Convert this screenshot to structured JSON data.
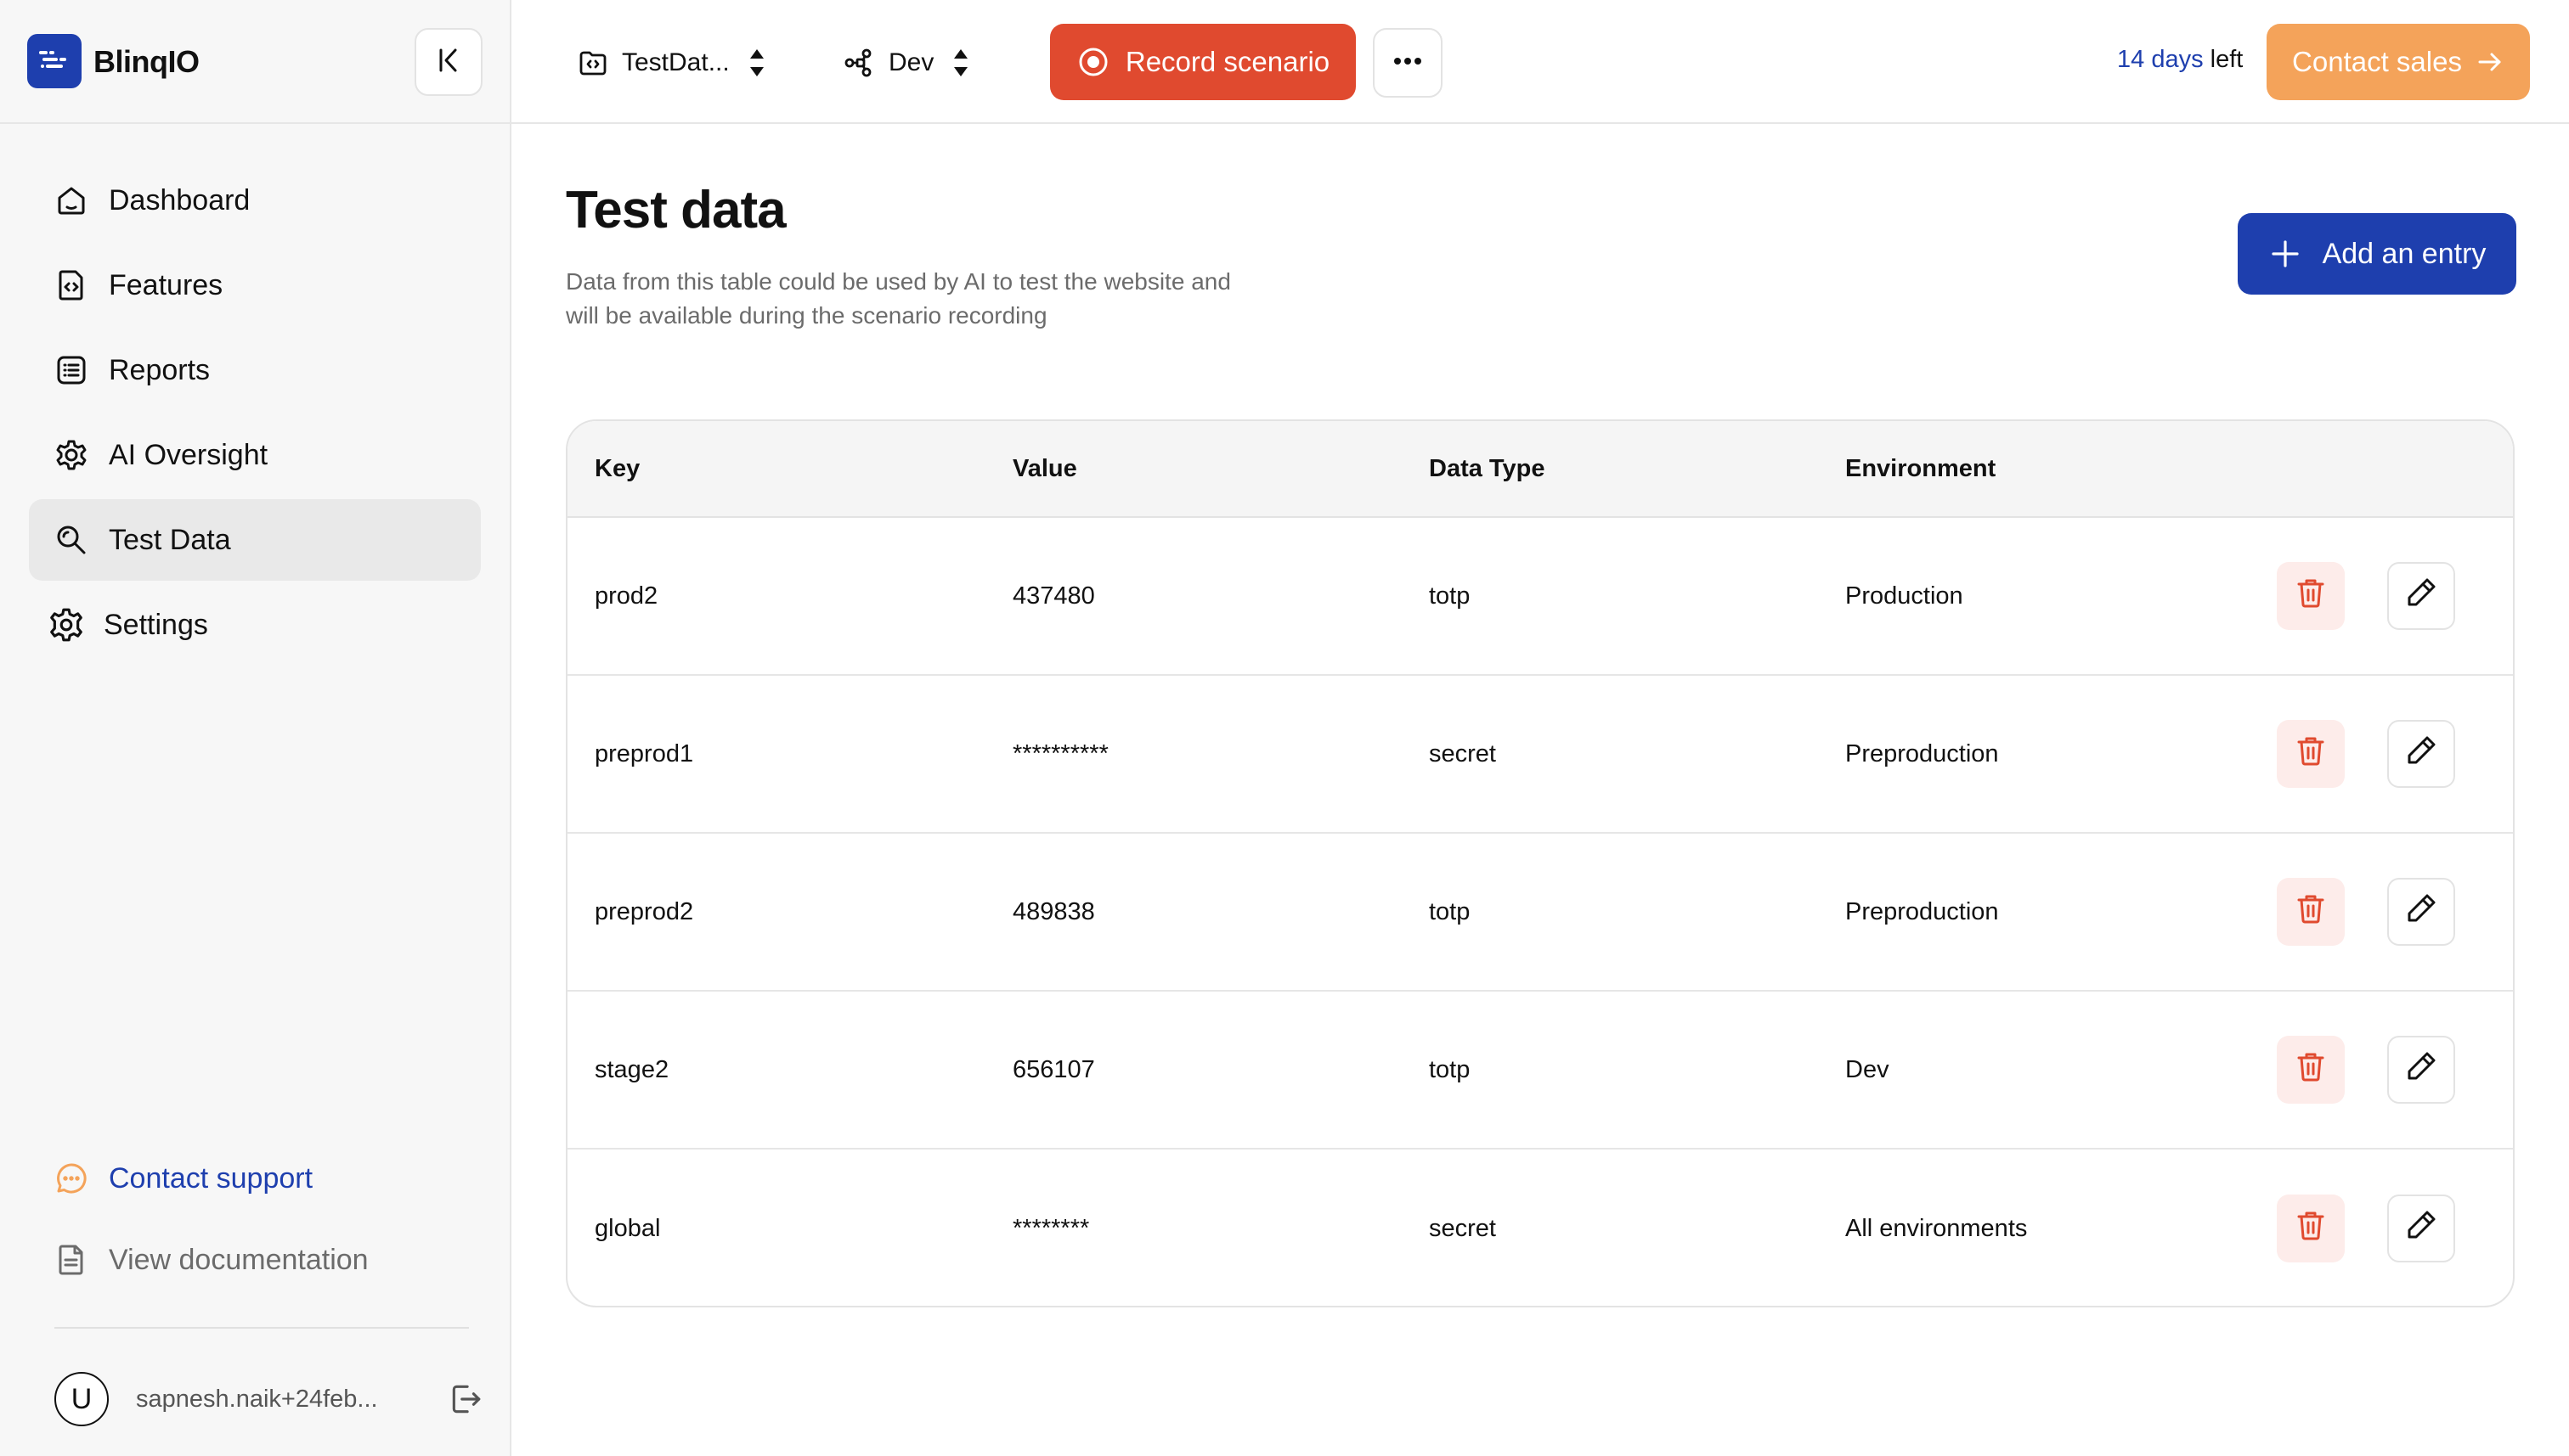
{
  "brand": {
    "name": "BlinqIO",
    "logo_icon": "blinqio-logo-icon"
  },
  "sidebar": {
    "items": [
      {
        "label": "Dashboard",
        "icon": "home-icon",
        "active": false
      },
      {
        "label": "Features",
        "icon": "feature-file-icon",
        "active": false
      },
      {
        "label": "Reports",
        "icon": "report-list-icon",
        "active": false
      },
      {
        "label": "AI Oversight",
        "icon": "ai-gear-icon",
        "active": false
      },
      {
        "label": "Test Data",
        "icon": "data-search-icon",
        "active": true
      },
      {
        "label": "Settings",
        "icon": "settings-icon",
        "active": false
      }
    ],
    "contact_support": "Contact support",
    "view_documentation": "View documentation",
    "user": {
      "initial": "U",
      "email": "sapnesh.naik+24feb..."
    }
  },
  "topbar": {
    "project_selector": "TestDat...",
    "environment_selector": "Dev",
    "record_label": "Record scenario",
    "trial_days": "14 days",
    "trial_suffix": " left",
    "contact_sales_label": "Contact sales"
  },
  "page": {
    "title": "Test data",
    "subtitle": "Data from this table could be used by AI to test the website and will be available during the scenario recording",
    "add_button": "Add an entry"
  },
  "table": {
    "columns": [
      "Key",
      "Value",
      "Data Type",
      "Environment"
    ],
    "rows": [
      {
        "key": "prod2",
        "value": "437480",
        "type": "totp",
        "environment": "Production"
      },
      {
        "key": "preprod1",
        "value": "**********",
        "type": "secret",
        "environment": "Preproduction"
      },
      {
        "key": "preprod2",
        "value": "489838",
        "type": "totp",
        "environment": "Preproduction"
      },
      {
        "key": "stage2",
        "value": "656107",
        "type": "totp",
        "environment": "Dev"
      },
      {
        "key": "global",
        "value": "********",
        "type": "secret",
        "environment": "All environments"
      }
    ]
  },
  "colors": {
    "primary": "#1e3fae",
    "record": "#e04a2f",
    "sales": "#f4a35a",
    "delete": "#e04a2f",
    "delete_bg": "#fdecea"
  }
}
